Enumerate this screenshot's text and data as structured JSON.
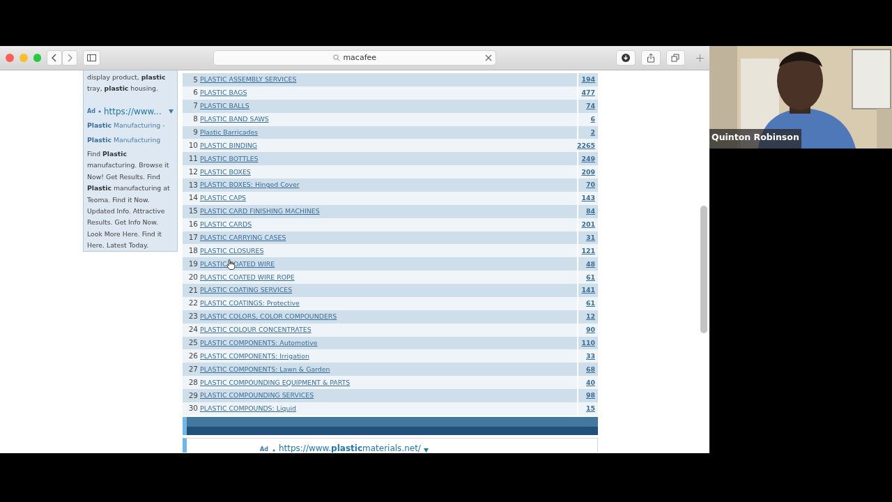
{
  "browser": {
    "address": "macafee"
  },
  "sidebar_ad": {
    "snippet": "display product, **plastic** tray, **plastic** housing.",
    "ad_label": "Ad",
    "url": "https://www...",
    "title_lines": [
      "**Plastic** Manufacturing -",
      "**Plastic** Manufacturing"
    ],
    "description": "Find **Plastic** manufacturing. Browse it Now! Get Results. Find **Plastic** manufacturing at Teoma. Find it Now. Updated Info. Attractive Results. Get Info Now. Look More Here. Find it Here. Latest Today."
  },
  "table": {
    "rows": [
      {
        "number": "5",
        "name": "PLASTIC ASSEMBLY SERVICES",
        "count": "194"
      },
      {
        "number": "6",
        "name": "PLASTIC BAGS",
        "count": "477"
      },
      {
        "number": "7",
        "name": "PLASTIC BALLS",
        "count": "74"
      },
      {
        "number": "8",
        "name": "PLASTIC BAND SAWS",
        "count": "6"
      },
      {
        "number": "9",
        "name": "Plastic Barricades",
        "count": "2"
      },
      {
        "number": "10",
        "name": "PLASTIC BINDING",
        "count": "2265"
      },
      {
        "number": "11",
        "name": "PLASTIC BOTTLES",
        "count": "249"
      },
      {
        "number": "12",
        "name": "PLASTIC BOXES",
        "count": "209"
      },
      {
        "number": "13",
        "name": "PLASTIC BOXES: Hinged Cover",
        "count": "70"
      },
      {
        "number": "14",
        "name": "PLASTIC CAPS",
        "count": "143"
      },
      {
        "number": "15",
        "name": "PLASTIC CARD FINISHING MACHINES",
        "count": "84"
      },
      {
        "number": "16",
        "name": "PLASTIC CARDS",
        "count": "201"
      },
      {
        "number": "17",
        "name": "PLASTIC CARRYING CASES",
        "count": "31"
      },
      {
        "number": "18",
        "name": "PLASTIC CLOSURES",
        "count": "121"
      },
      {
        "number": "19",
        "name": "PLASTIC COATED WIRE",
        "count": "48"
      },
      {
        "number": "20",
        "name": "PLASTIC COATED WIRE ROPE",
        "count": "61"
      },
      {
        "number": "21",
        "name": "PLASTIC COATING SERVICES",
        "count": "141"
      },
      {
        "number": "22",
        "name": "PLASTIC COATINGS: Protective",
        "count": "61"
      },
      {
        "number": "23",
        "name": "PLASTIC COLORS, COLOR COMPOUNDERS",
        "count": "12"
      },
      {
        "number": "24",
        "name": "PLASTIC COLOUR CONCENTRATES",
        "count": "90"
      },
      {
        "number": "25",
        "name": "PLASTIC COMPONENTS: Automotive",
        "count": "110"
      },
      {
        "number": "26",
        "name": "PLASTIC COMPONENTS: Irrigation",
        "count": "33"
      },
      {
        "number": "27",
        "name": "PLASTIC COMPONENTS: Lawn & Garden",
        "count": "68"
      },
      {
        "number": "28",
        "name": "PLASTIC COMPOUNDING EQUIPMENT & PARTS",
        "count": "40"
      },
      {
        "number": "29",
        "name": "PLASTIC COMPOUNDING SERVICES",
        "count": "98"
      },
      {
        "number": "30",
        "name": "PLASTIC COMPOUNDS: Liquid",
        "count": "15"
      }
    ]
  },
  "bottom_ad": {
    "ad_label": "Ad",
    "url": "https://www.**plastic**materials.net/"
  },
  "video": {
    "participant": "Quinton Robinson"
  }
}
